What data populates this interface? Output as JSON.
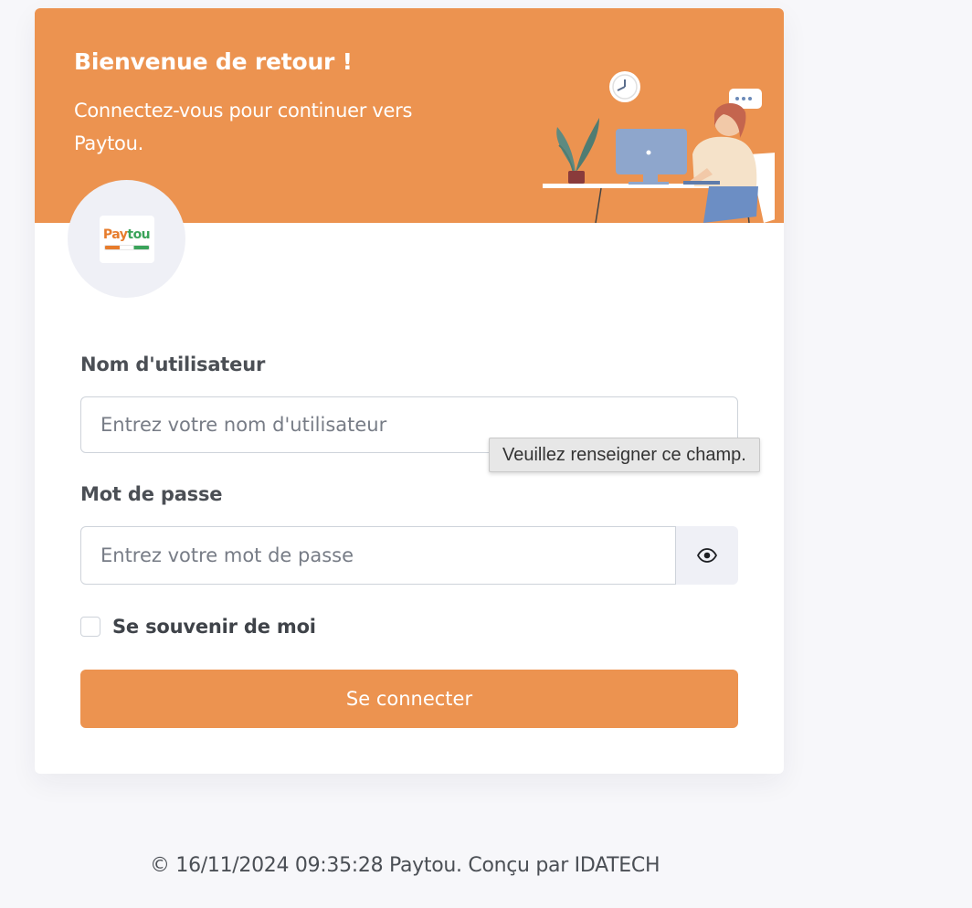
{
  "header": {
    "title": "Bienvenue de retour !",
    "subtitle": "Connectez-vous pour continuer vers Paytou."
  },
  "logo": {
    "text": "Paytou",
    "colors": [
      "#e77c2c",
      "#3aa35a"
    ]
  },
  "form": {
    "username": {
      "label": "Nom d'utilisateur",
      "placeholder": "Entrez votre nom d'utilisateur",
      "value": ""
    },
    "password": {
      "label": "Mot de passe",
      "placeholder": "Entrez votre mot de passe",
      "value": "",
      "toggle_icon": "eye-icon"
    },
    "remember": {
      "label": "Se souvenir de moi",
      "checked": false
    },
    "submit_label": "Se connecter"
  },
  "tooltip": {
    "text": "Veuillez renseigner ce champ."
  },
  "footer": {
    "text": "© 16/11/2024 09:35:28 Paytou. Conçu par IDATECH"
  },
  "colors": {
    "accent": "#ec9350",
    "background": "#f7f7fa"
  }
}
